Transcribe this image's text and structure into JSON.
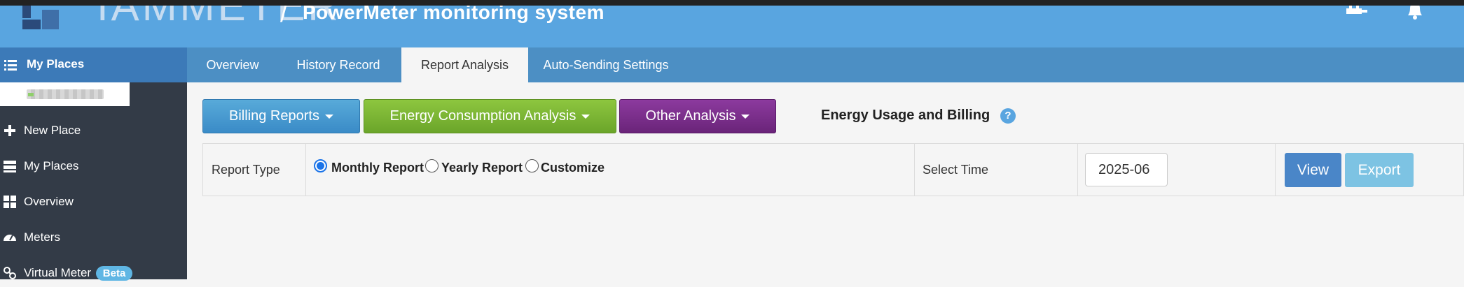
{
  "header": {
    "logo_text": "IAMMETER",
    "separator": "/",
    "app_title": "PowerMeter monitoring system"
  },
  "tabs": [
    {
      "label": "Overview",
      "active": false
    },
    {
      "label": "History Record",
      "active": false
    },
    {
      "label": "Report Analysis",
      "active": true
    },
    {
      "label": "Auto-Sending Settings",
      "active": false
    }
  ],
  "sidebar": {
    "header_label": "My Places",
    "items": [
      {
        "label": "New Place",
        "icon": "plus-icon"
      },
      {
        "label": "My Places",
        "icon": "server-icon"
      },
      {
        "label": "Overview",
        "icon": "grid-icon"
      },
      {
        "label": "Meters",
        "icon": "gauge-icon"
      },
      {
        "label": "Virtual Meter",
        "icon": "link-icon",
        "badge": "Beta"
      }
    ]
  },
  "toolbar": {
    "billing_label": "Billing Reports",
    "energy_label": "Energy Consumption Analysis",
    "other_label": "Other Analysis",
    "heading": "Energy Usage and Billing",
    "help_glyph": "?"
  },
  "filter": {
    "report_type_label": "Report Type",
    "options": [
      {
        "label": "Monthly Report",
        "checked": true
      },
      {
        "label": "Yearly Report",
        "checked": false
      },
      {
        "label": "Customize",
        "checked": false
      }
    ],
    "select_time_label": "Select Time",
    "time_value": "2025-06",
    "view_label": "View",
    "export_label": "Export"
  },
  "colors": {
    "header_blue": "#59a5e0",
    "tab_bar": "#4c8fc4",
    "sidebar_bg": "#333b47",
    "billing_btn": "#3a8bc7",
    "energy_btn": "#6ba52a",
    "other_btn": "#6a2479",
    "view_btn": "#4a86c8",
    "export_btn": "#7dc3e3"
  }
}
